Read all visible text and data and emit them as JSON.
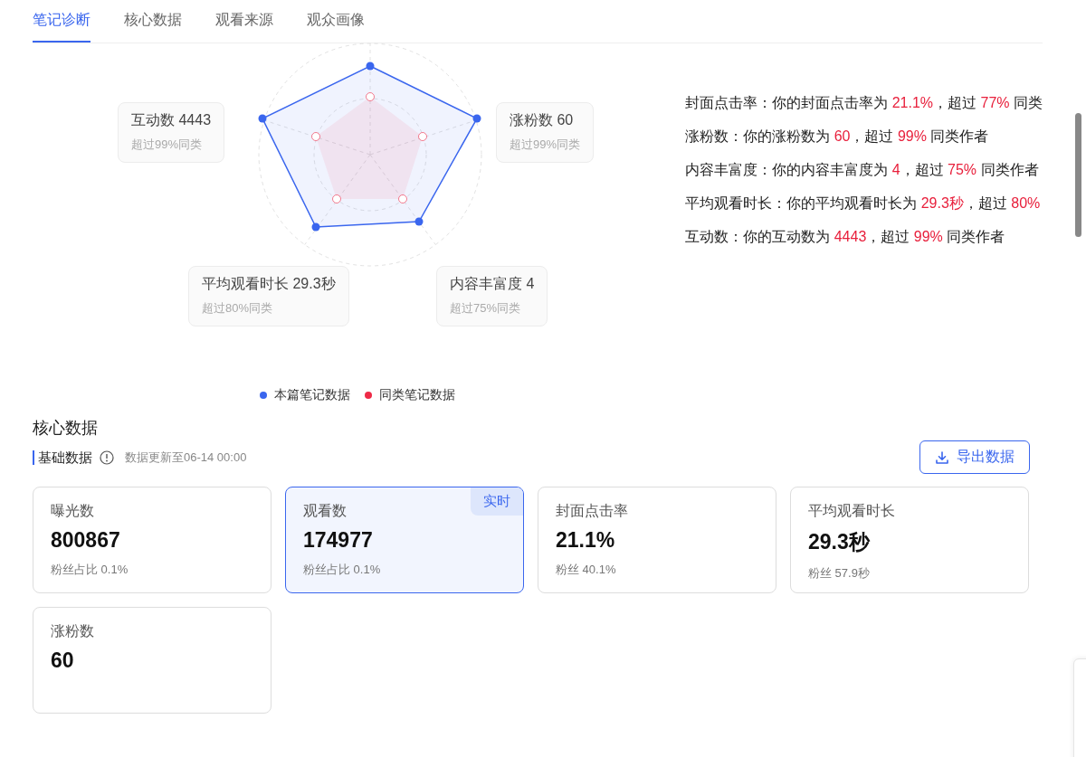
{
  "tabs": [
    {
      "label": "笔记诊断",
      "selected": true
    },
    {
      "label": "核心数据",
      "selected": false
    },
    {
      "label": "观看来源",
      "selected": false
    },
    {
      "label": "观众画像",
      "selected": false
    }
  ],
  "radar": {
    "callouts": [
      {
        "title": "互动数 4443",
        "sub": "超过99%同类"
      },
      {
        "title": "涨粉数 60",
        "sub": "超过99%同类"
      },
      {
        "title": "平均观看时长 29.3秒",
        "sub": "超过80%同类"
      },
      {
        "title": "内容丰富度 4",
        "sub": "超过75%同类"
      }
    ],
    "legend": [
      {
        "label": "本篇笔记数据",
        "color": "#3a66ee"
      },
      {
        "label": "同类笔记数据",
        "color": "#ee2a47"
      }
    ]
  },
  "summary": [
    [
      {
        "text": "封面点击率：你的封面点击率为 ",
        "highlight": false
      },
      {
        "text": "21.1%",
        "highlight": true
      },
      {
        "text": "，超过 ",
        "highlight": false
      },
      {
        "text": "77%",
        "highlight": true
      },
      {
        "text": " 同类",
        "highlight": false
      }
    ],
    [
      {
        "text": "涨粉数：你的涨粉数为 ",
        "highlight": false
      },
      {
        "text": "60",
        "highlight": true
      },
      {
        "text": "，超过 ",
        "highlight": false
      },
      {
        "text": "99%",
        "highlight": true
      },
      {
        "text": " 同类作者",
        "highlight": false
      }
    ],
    [
      {
        "text": "内容丰富度：你的内容丰富度为 ",
        "highlight": false
      },
      {
        "text": "4",
        "highlight": true
      },
      {
        "text": "，超过 ",
        "highlight": false
      },
      {
        "text": "75%",
        "highlight": true
      },
      {
        "text": " 同类作者",
        "highlight": false
      }
    ],
    [
      {
        "text": "平均观看时长：你的平均观看时长为 ",
        "highlight": false
      },
      {
        "text": "29.3秒",
        "highlight": true
      },
      {
        "text": "，超过 ",
        "highlight": false
      },
      {
        "text": "80%",
        "highlight": true
      }
    ],
    [
      {
        "text": "互动数：你的互动数为 ",
        "highlight": false
      },
      {
        "text": "4443",
        "highlight": true
      },
      {
        "text": "，超过 ",
        "highlight": false
      },
      {
        "text": "99%",
        "highlight": true
      },
      {
        "text": " 同类作者",
        "highlight": false
      }
    ]
  ],
  "core": {
    "title": "核心数据",
    "subtitle": "基础数据",
    "updated": "数据更新至06-14 00:00",
    "export_button": "导出数据",
    "cards": [
      {
        "label": "曝光数",
        "value": "800867",
        "sub": "粉丝占比 0.1%",
        "selected": false
      },
      {
        "label": "观看数",
        "value": "174977",
        "sub": "粉丝占比 0.1%",
        "selected": true,
        "badge": "实时"
      },
      {
        "label": "封面点击率",
        "value": "21.1%",
        "sub": "粉丝 40.1%",
        "selected": false
      },
      {
        "label": "平均观看时长",
        "value": "29.3秒",
        "sub": "粉丝 57.9秒",
        "selected": false
      },
      {
        "label": "涨粉数",
        "value": "60",
        "selected": false
      }
    ]
  }
}
